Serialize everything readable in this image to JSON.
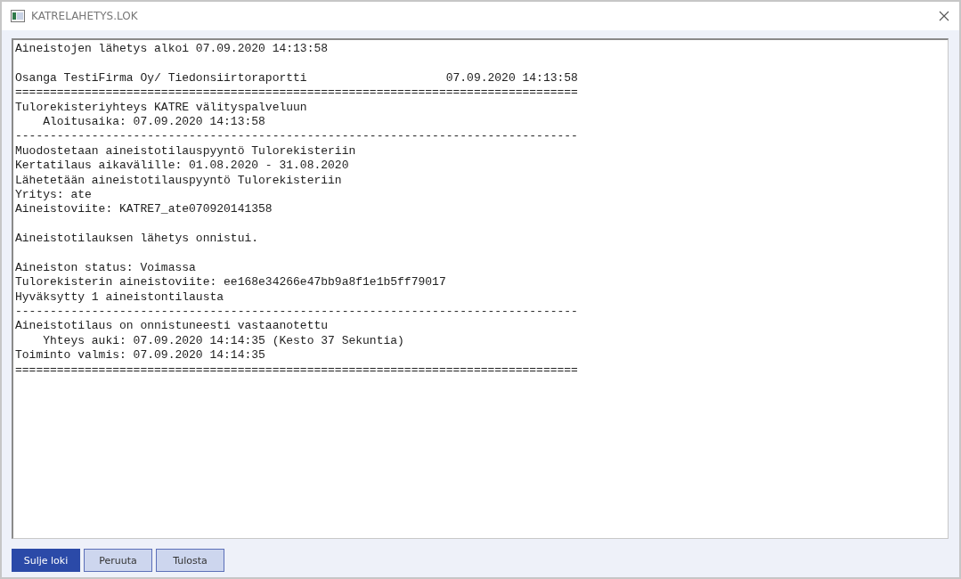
{
  "window": {
    "title": "KATRELAHETYS.LOK"
  },
  "log": {
    "lines": [
      {
        "kind": "line",
        "text": "Aineistojen lähetys alkoi 07.09.2020 14:13:58"
      },
      {
        "kind": "blank"
      },
      {
        "kind": "line",
        "text": "Osanga TestiFirma Oy/ Tiedonsiirtoraportti                    07.09.2020 14:13:58"
      },
      {
        "kind": "line",
        "text": "================================================================================="
      },
      {
        "kind": "line",
        "text": "Tulorekisteriyhteys KATRE välityspalveluun"
      },
      {
        "kind": "line",
        "text": "    Aloitusaika: 07.09.2020 14:13:58"
      },
      {
        "kind": "line",
        "text": "---------------------------------------------------------------------------------"
      },
      {
        "kind": "line",
        "text": "Muodostetaan aineistotilauspyyntö Tulorekisteriin"
      },
      {
        "kind": "line",
        "text": "Kertatilaus aikavälille: 01.08.2020 - 31.08.2020"
      },
      {
        "kind": "line",
        "text": "Lähetetään aineistotilauspyyntö Tulorekisteriin"
      },
      {
        "kind": "line",
        "text": "Yritys: ate"
      },
      {
        "kind": "line",
        "text": "Aineistoviite: KATRE7_ate070920141358"
      },
      {
        "kind": "blank"
      },
      {
        "kind": "line",
        "text": "Aineistotilauksen lähetys onnistui."
      },
      {
        "kind": "blank"
      },
      {
        "kind": "line",
        "text": "Aineiston status: Voimassa"
      },
      {
        "kind": "line",
        "text": "Tulorekisterin aineistoviite: ee168e34266e47bb9a8f1e1b5ff79017"
      },
      {
        "kind": "line",
        "text": "Hyväksytty 1 aineistontilausta"
      },
      {
        "kind": "line",
        "text": "---------------------------------------------------------------------------------"
      },
      {
        "kind": "line",
        "text": "Aineistotilaus on onnistuneesti vastaanotettu"
      },
      {
        "kind": "line",
        "text": "    Yhteys auki: 07.09.2020 14:14:35 (Kesto 37 Sekuntia)"
      },
      {
        "kind": "line",
        "text": "Toiminto valmis: 07.09.2020 14:14:35"
      },
      {
        "kind": "line",
        "text": "================================================================================="
      }
    ]
  },
  "buttons": [
    {
      "label": "Sulje loki",
      "primary": true
    },
    {
      "label": "Peruuta",
      "primary": false
    },
    {
      "label": "Tulosta",
      "primary": false
    }
  ]
}
